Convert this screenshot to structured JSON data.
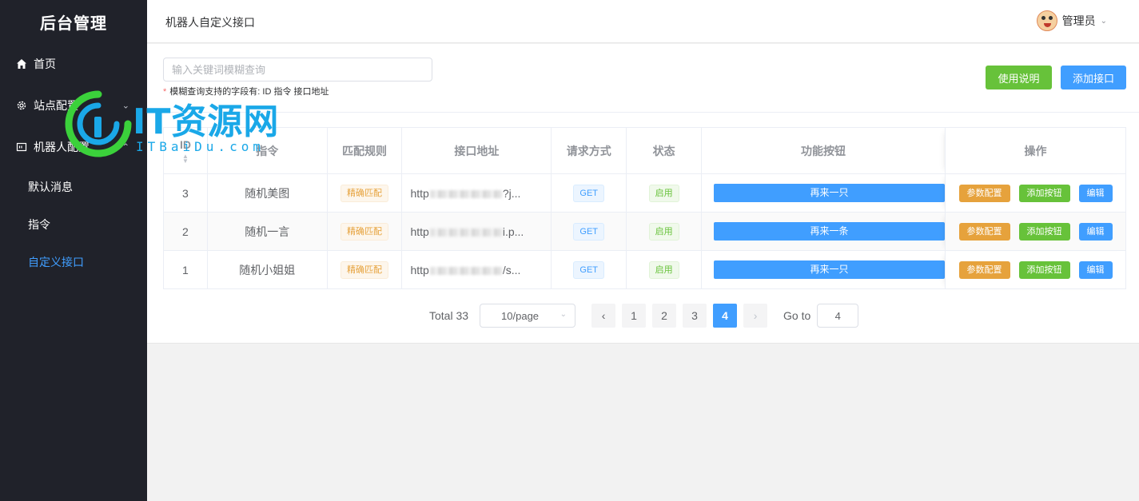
{
  "sidebar": {
    "brand": "后台管理",
    "items": [
      {
        "label": "首页",
        "icon": "home-icon"
      },
      {
        "label": "站点配置",
        "icon": "gear-icon"
      },
      {
        "label": "机器人配置",
        "icon": "robot-icon"
      }
    ],
    "sub_items": [
      {
        "label": "默认消息"
      },
      {
        "label": "指令"
      },
      {
        "label": "自定义接口",
        "active": true
      }
    ]
  },
  "watermark": {
    "text": "IT资源网",
    "sub": "ITBaiDu.com"
  },
  "header": {
    "title": "机器人自定义接口",
    "user": "管理员"
  },
  "toolbar": {
    "search_placeholder": "输入关键词模糊查询",
    "hint": "模糊查询支持的字段有: ID 指令 接口地址",
    "help_label": "使用说明",
    "add_label": "添加接口"
  },
  "table": {
    "columns": [
      "ID",
      "指令",
      "匹配规则",
      "接口地址",
      "请求方式",
      "状态",
      "功能按钮",
      "操作"
    ],
    "rows": [
      {
        "id": "3",
        "command": "随机美图",
        "rule": "精确匹配",
        "url_prefix": "http",
        "url_suffix": "?j...",
        "method": "GET",
        "status": "启用",
        "fn_button": "再来一只"
      },
      {
        "id": "2",
        "command": "随机一言",
        "rule": "精确匹配",
        "url_prefix": "http",
        "url_suffix": "i.p...",
        "method": "GET",
        "status": "启用",
        "fn_button": "再来一条"
      },
      {
        "id": "1",
        "command": "随机小姐姐",
        "rule": "精确匹配",
        "url_prefix": "http",
        "url_suffix": "/s...",
        "method": "GET",
        "status": "启用",
        "fn_button": "再来一只"
      }
    ],
    "actions": {
      "params": "参数配置",
      "add_button": "添加按钮",
      "edit": "编辑"
    }
  },
  "pagination": {
    "total": "Total 33",
    "page_size": "10/page",
    "pages": [
      "1",
      "2",
      "3",
      "4"
    ],
    "current": "4",
    "goto_label": "Go to",
    "goto_value": "4"
  },
  "colors": {
    "primary": "#409eff",
    "success": "#67c23a",
    "warning": "#e6a23c",
    "sidebar_bg": "#20222a"
  }
}
